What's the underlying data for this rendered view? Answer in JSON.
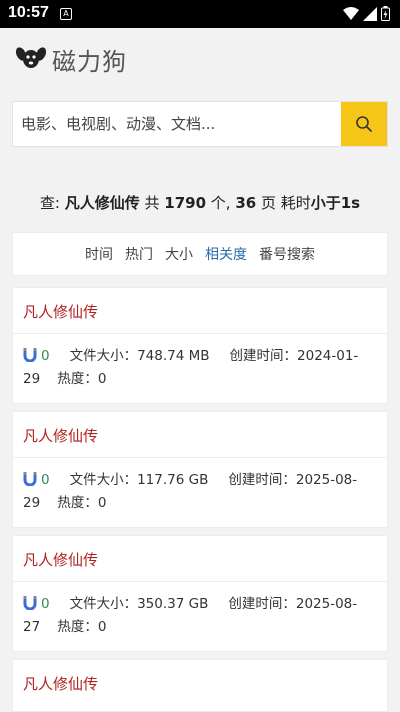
{
  "status": {
    "time": "10:57",
    "notif_glyph": "A"
  },
  "app": {
    "title": "磁力狗"
  },
  "search": {
    "placeholder": "电影、电视剧、动漫、文档..."
  },
  "summary": {
    "prefix": "查: ",
    "query": "凡人修仙传",
    "mid1": " 共 ",
    "count": "1790",
    "mid2": " 个, ",
    "pages": "36",
    "mid3": " 页 耗时",
    "time": "小于1s"
  },
  "sort_tabs": [
    {
      "label": "时间"
    },
    {
      "label": "热门"
    },
    {
      "label": "大小"
    },
    {
      "label": "相关度"
    },
    {
      "label": "番号搜索"
    }
  ],
  "results": [
    {
      "title": "凡人修仙传",
      "count": "0",
      "size": "文件大小：748.74 MB",
      "created": "创建时间：2024-01-29",
      "heat": "热度：0"
    },
    {
      "title": "凡人修仙传",
      "count": "0",
      "size": "文件大小：117.76 GB",
      "created": "创建时间：2025-08-29",
      "heat": "热度：0"
    },
    {
      "title": "凡人修仙传",
      "count": "0",
      "size": "文件大小：350.37 GB",
      "created": "创建时间：2025-08-27",
      "heat": "热度：0"
    },
    {
      "title": "凡人修仙传"
    }
  ],
  "colors": {
    "accent": "#f5c518",
    "title_red": "#b22222",
    "active_tab": "#2a6dad",
    "count_green": "#2e8b57"
  }
}
